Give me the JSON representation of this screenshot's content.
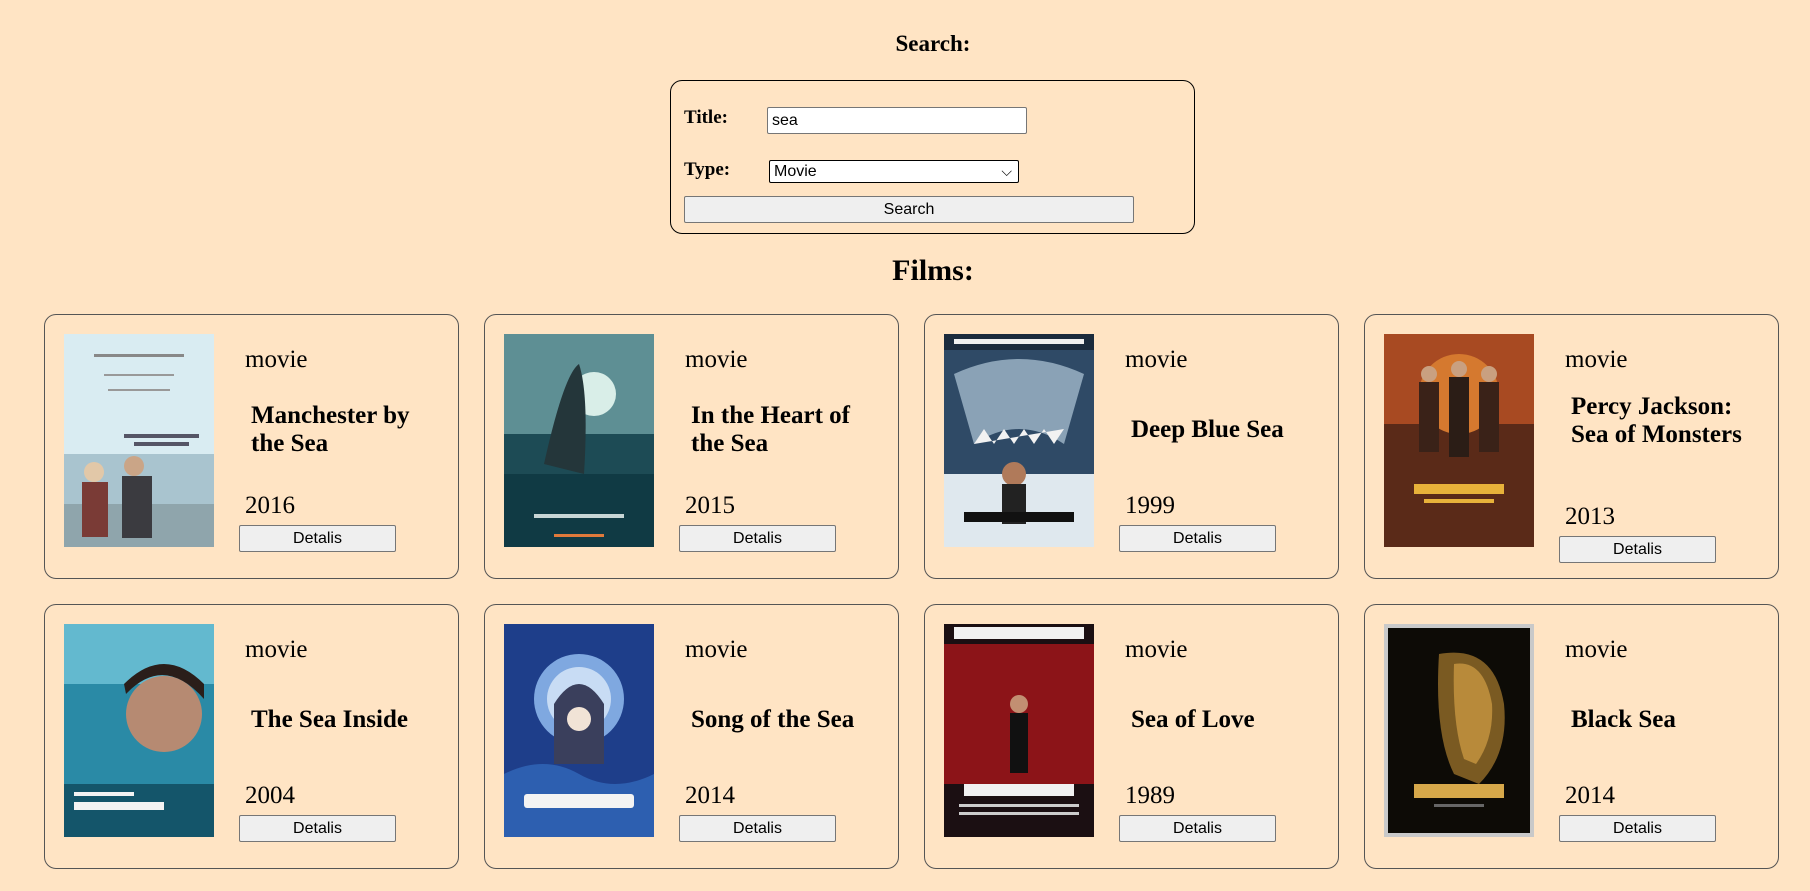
{
  "search": {
    "heading": "Search:",
    "title_label": "Title:",
    "title_value": "sea",
    "type_label": "Type:",
    "type_selected": "Movie",
    "button_label": "Search"
  },
  "films": {
    "heading": "Films:",
    "details_label": "Detalis",
    "items": [
      {
        "type": "movie",
        "title": "Manchester by the Sea",
        "year": "2016"
      },
      {
        "type": "movie",
        "title": "In the Heart of the Sea",
        "year": "2015"
      },
      {
        "type": "movie",
        "title": "Deep Blue Sea",
        "year": "1999"
      },
      {
        "type": "movie",
        "title": "Percy Jackson: Sea of Monsters",
        "year": "2013"
      },
      {
        "type": "movie",
        "title": "The Sea Inside",
        "year": "2004"
      },
      {
        "type": "movie",
        "title": "Song of the Sea",
        "year": "2014"
      },
      {
        "type": "movie",
        "title": "Sea of Love",
        "year": "1989"
      },
      {
        "type": "movie",
        "title": "Black Sea",
        "year": "2014"
      }
    ]
  },
  "colors": {
    "background": "#ffe4c4",
    "button": "#efefef"
  }
}
